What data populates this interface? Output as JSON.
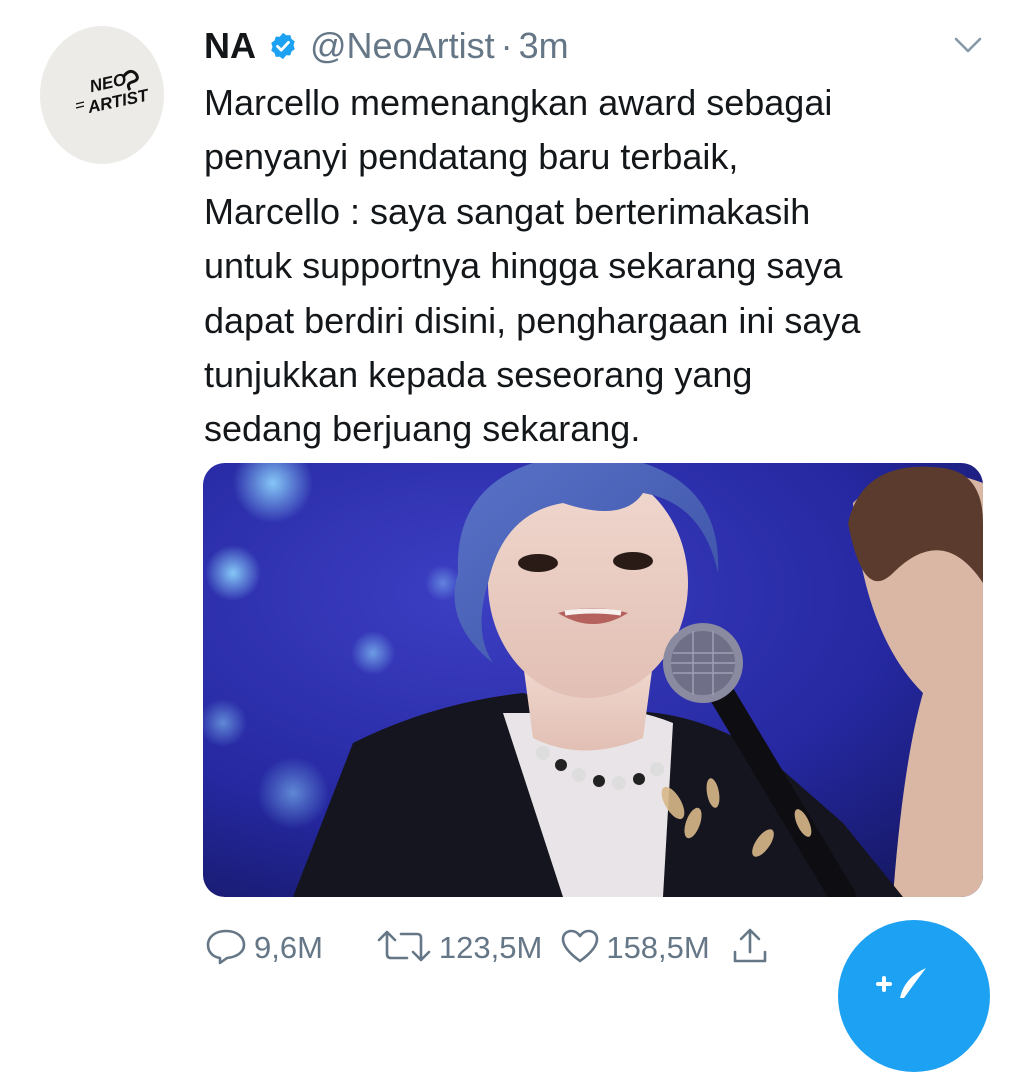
{
  "avatar": {
    "logo_text_1": "NEO",
    "logo_text_2": "ARTIST"
  },
  "author": {
    "name": "NA",
    "handle": "@NeoArtist",
    "separator": "·",
    "time": "3m"
  },
  "tweet": {
    "lines": [
      "Marcello memenangkan award sebagai",
      "penyanyi pendatang baru terbaik,",
      "Marcello : saya sangat berterimakasih",
      "untuk supportnya hingga sekarang saya",
      "dapat berdiri disini, penghargaan ini saya",
      "tunjukkan kepada seseorang yang",
      "sedang berjuang sekarang."
    ]
  },
  "actions": {
    "replies": "9,6M",
    "retweets": "123,5M",
    "likes": "158,5M"
  },
  "icons": {
    "verified": "verified-badge-icon",
    "menu": "chevron-down-icon",
    "reply": "speech-bubble-icon",
    "retweet": "retweet-arrows-icon",
    "like": "heart-icon",
    "share": "share-arrow-icon",
    "compose": "feather-plus-icon"
  },
  "colors": {
    "accent": "#1da1f2",
    "muted": "#657786",
    "text": "#14171a"
  }
}
